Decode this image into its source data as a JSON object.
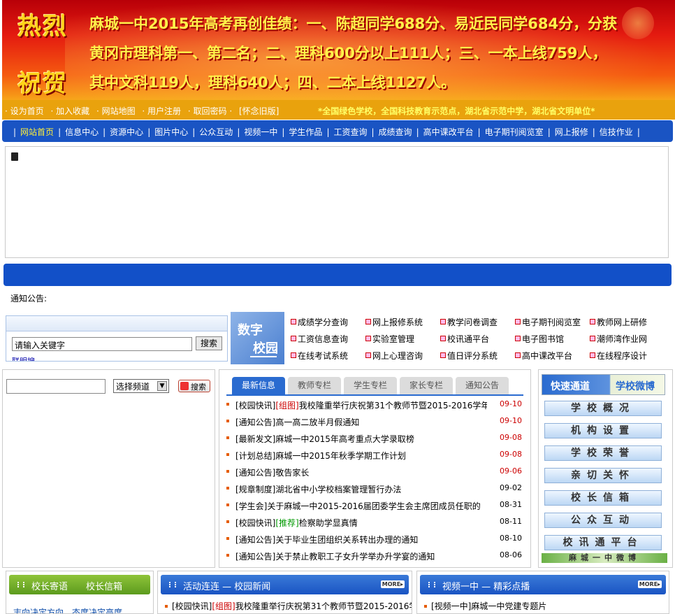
{
  "banner": {
    "left_top": "热烈",
    "left_bottom": "祝贺",
    "lines": [
      "麻城一中2015年高考再创佳绩：一、陈超同学688分、易近民同学684分，分获",
      "黄冈市理科第一、第二名；二、理科600分以上111人；三、一本上线759人，",
      "其中文科119人，理科640人；四、二本上线1127人。"
    ]
  },
  "topbar": {
    "links": [
      "· 设为首页",
      "· 加入收藏",
      "· 网站地图",
      "· 用户注册",
      "· 取回密码 ·",
      "[怀念旧版]"
    ],
    "motto": "*全国绿色学校，全国科技教育示范点，湖北省示范中学，湖北省文明单位*"
  },
  "nav": {
    "items": [
      "网站首页",
      "信息中心",
      "资源中心",
      "图片中心",
      "公众互动",
      "视频一中",
      "学生作品",
      "工资查询",
      "成绩查询",
      "高中课改平台",
      "电子期刊阅览室",
      "网上报修",
      "信技作业"
    ],
    "current": "网站首页"
  },
  "notice": {
    "label": "通知公告:"
  },
  "search": {
    "keyword_value": "请输入关键字",
    "button": "搜索",
    "link": "联明搜"
  },
  "digital": {
    "line1": "数字",
    "line2": "校园"
  },
  "quicklinks": [
    "成绩学分查询",
    "网上报修系统",
    "教学问卷调查",
    "电子期刊阅览室",
    "教师网上研修",
    "工资信息查询",
    "实验室管理",
    "校讯通平台",
    "电子图书馆",
    "潮师湾作业网",
    "在线考试系统",
    "网上心理咨询",
    "值日评分系统",
    "高中课改平台",
    "在线程序设计"
  ],
  "site_search": {
    "input_value": "",
    "select_value": "选择频道",
    "button": "搜索"
  },
  "news": {
    "tabs": [
      "最新信息",
      "教师专栏",
      "学生专栏",
      "家长专栏",
      "通知公告"
    ],
    "active_tab": "最新信息",
    "items": [
      {
        "cat": "[校园快讯]",
        "tag": "[组图]",
        "tag_color": "red",
        "title": "我校隆重举行庆祝第31个教师节暨2015-2016学年",
        "date": "09-10",
        "date_color": "red"
      },
      {
        "cat": "[通知公告]",
        "tag": "",
        "tag_color": "",
        "title": "高一高二放半月假通知",
        "date": "09-10",
        "date_color": "red"
      },
      {
        "cat": "[最新发文]",
        "tag": "",
        "tag_color": "",
        "title": "麻城一中2015年高考重点大学录取榜",
        "date": "09-08",
        "date_color": "red"
      },
      {
        "cat": "[计划总结]",
        "tag": "",
        "tag_color": "",
        "title": "麻城一中2015年秋季学期工作计划",
        "date": "09-08",
        "date_color": "red"
      },
      {
        "cat": "[通知公告]",
        "tag": "",
        "tag_color": "",
        "title": "敬告家长",
        "date": "09-06",
        "date_color": "red"
      },
      {
        "cat": "[规章制度]",
        "tag": "",
        "tag_color": "",
        "title": "湖北省中小学校档案管理暂行办法",
        "date": "09-02",
        "date_color": "black"
      },
      {
        "cat": "[学生会]",
        "tag": "",
        "tag_color": "",
        "title": "关于麻城一中2015-2016届团委学生会主席团成员任职的",
        "date": "08-31",
        "date_color": "black"
      },
      {
        "cat": "[校园快讯]",
        "tag": "[推荐]",
        "tag_color": "green",
        "title": "检察助学显真情",
        "date": "08-11",
        "date_color": "black"
      },
      {
        "cat": "[通知公告]",
        "tag": "",
        "tag_color": "",
        "title": "关于毕业生团组织关系转出办理的通知",
        "date": "08-10",
        "date_color": "black"
      },
      {
        "cat": "[通知公告]",
        "tag": "",
        "tag_color": "",
        "title": "关于禁止教职工子女升学举办升学宴的通知",
        "date": "08-06",
        "date_color": "black"
      }
    ]
  },
  "quick_access": {
    "title_left": "快速通道",
    "title_right": "学校微博",
    "buttons": [
      "学校概况",
      "机构设置",
      "学校荣誉",
      "亲切关怀",
      "校长信箱",
      "公众互动",
      "校讯通平台"
    ],
    "weibo_strip": "麻城一中微博"
  },
  "bottom": {
    "principal": {
      "title": "校长寄语　　校长信箱",
      "text": "志向决定方向，态度决定高度"
    },
    "activities": {
      "title": "活动连连 — 校园新闻",
      "more": "MORE▸",
      "item_cat": "[校园快讯]",
      "item_tag": "[组图]",
      "item_title": "我校隆重举行庆祝第31个教师节暨2015-2016学"
    },
    "video": {
      "title": "视频一中 — 精彩点播",
      "more": "MORE▸",
      "item": "[视频一中]麻城一中党建专题片"
    }
  },
  "colors": {
    "nav_blue": "#1a54c3",
    "topbar_orange": "#e9a20d",
    "tab_blue": "#2a6bd0",
    "banner_red": "#e41a10"
  }
}
